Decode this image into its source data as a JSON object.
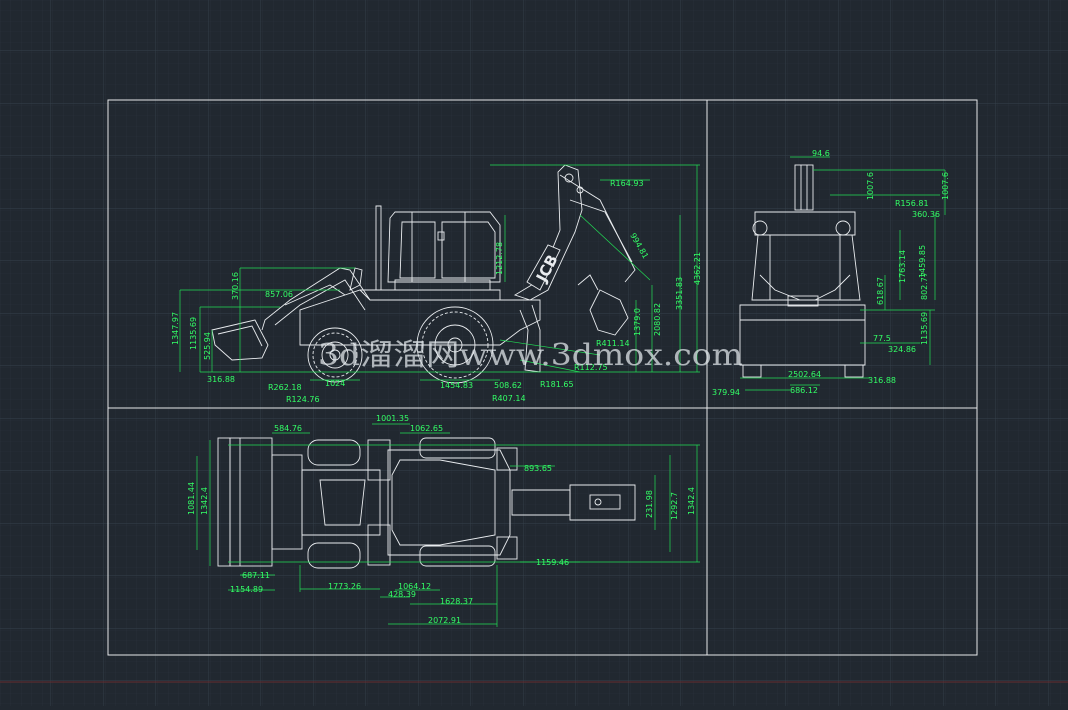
{
  "colors": {
    "background": "#212830",
    "grid_minor": "#2a323b",
    "grid_major": "#323c47",
    "frame": "#e6e8ea",
    "drawing": "#e9ecef",
    "dimension": "#33ff66",
    "bottom_line": "#7a2a2a"
  },
  "watermark": {
    "text": "3d溜溜网www.3dmox.com"
  },
  "side_view": {
    "logo": "JCB",
    "dims": [
      "R164.93",
      "1212.78",
      "994.81",
      "3351.83",
      "4362.21",
      "1379.0",
      "2080.82",
      "R411.14",
      "R112.75",
      "1454.83",
      "R181.65",
      "508.62",
      "R407.14",
      "1024",
      "R262.18",
      "R124.76",
      "316.88",
      "857.06",
      "370.16",
      "1347.97",
      "1135.69",
      "525.94"
    ]
  },
  "front_view": {
    "dims": [
      "94.6",
      "1007.6",
      "1007.6",
      "R156.81",
      "360.36",
      "1459.85",
      "1763.14",
      "802.77",
      "618.67",
      "1135.69",
      "77.5",
      "324.86",
      "2502.64",
      "316.88",
      "379.94",
      "686.12"
    ]
  },
  "top_view": {
    "dims": [
      "1001.35",
      "1062.65",
      "584.76",
      "893.65",
      "1081.44",
      "1342.4",
      "1292.7",
      "1342.4",
      "231.98",
      "1159.46",
      "687.11",
      "1154.89",
      "1773.26",
      "1064.12",
      "428.39",
      "1628.37",
      "2072.91"
    ]
  }
}
